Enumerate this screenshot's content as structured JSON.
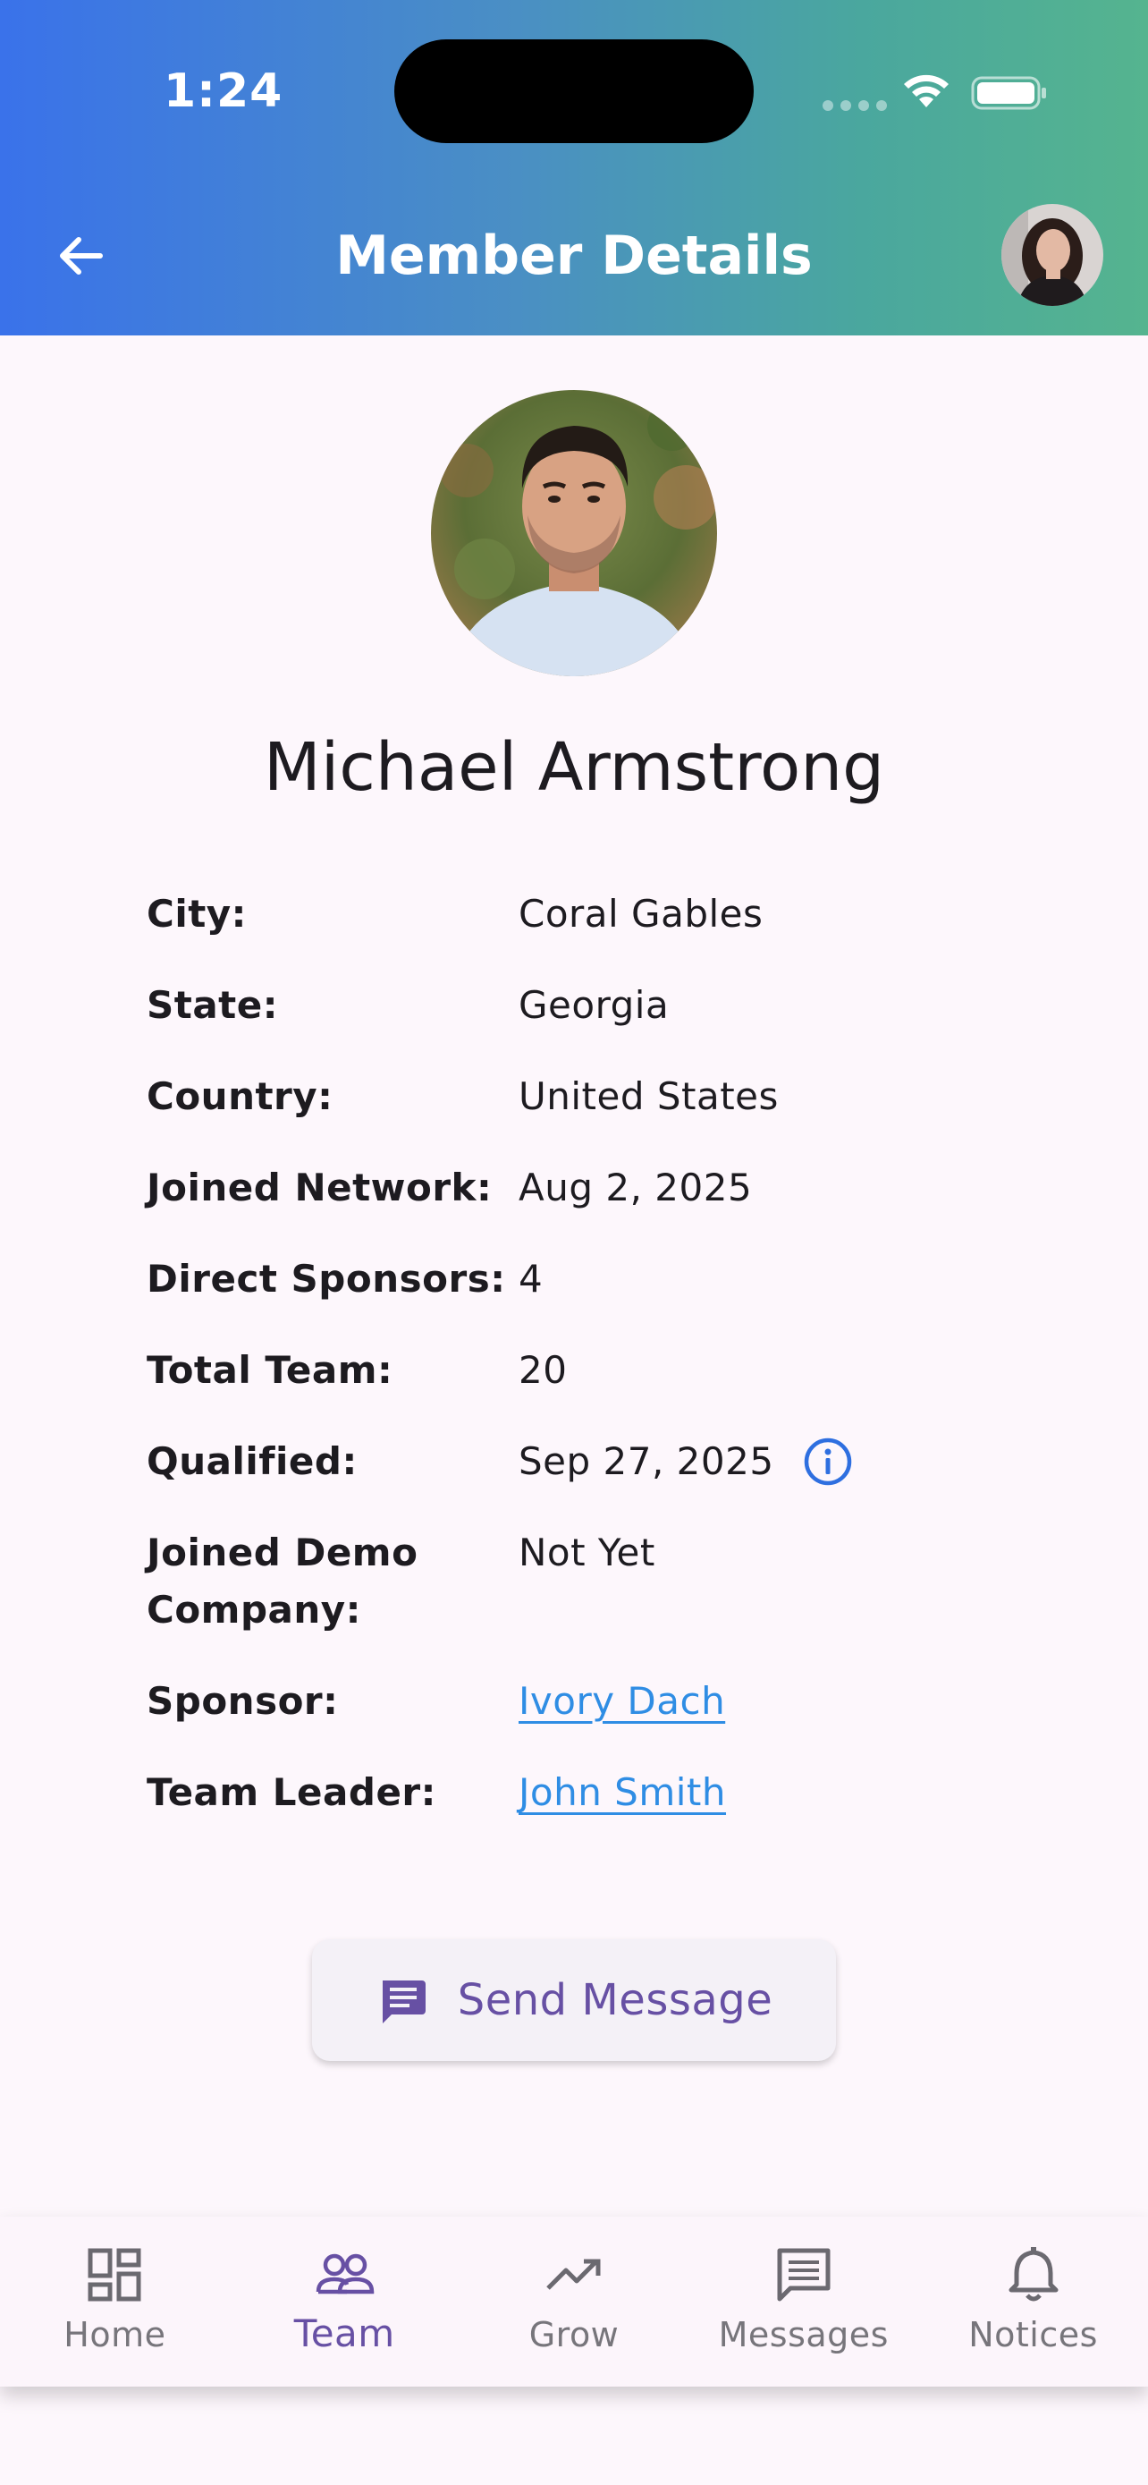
{
  "status_bar": {
    "time": "1:24"
  },
  "header": {
    "title": "Member Details"
  },
  "member": {
    "name": "Michael Armstrong"
  },
  "details": [
    {
      "label": "City:",
      "value": "Coral Gables"
    },
    {
      "label": "State:",
      "value": "Georgia"
    },
    {
      "label": "Country:",
      "value": "United States"
    },
    {
      "label": "Joined Network:",
      "value": "Aug 2, 2025"
    },
    {
      "label": "Direct Sponsors:",
      "value": "4"
    },
    {
      "label": "Total Team:",
      "value": "20"
    },
    {
      "label": "Qualified:",
      "value": "Sep 27, 2025"
    },
    {
      "label": "Joined Demo Company:",
      "value": "Not Yet"
    },
    {
      "label": "Sponsor:",
      "value": "Ivory Dach"
    },
    {
      "label": "Team Leader:",
      "value": "John Smith"
    }
  ],
  "actions": {
    "send_message": "Send Message"
  },
  "nav": {
    "items": [
      {
        "label": "Home",
        "icon": "dashboard-icon"
      },
      {
        "label": "Team",
        "icon": "team-icon"
      },
      {
        "label": "Grow",
        "icon": "trending-up-icon"
      },
      {
        "label": "Messages",
        "icon": "message-icon"
      },
      {
        "label": "Notices",
        "icon": "bell-icon"
      }
    ],
    "active": "Team"
  },
  "colors": {
    "accent": "#6750a4",
    "link": "#2f8de4",
    "info": "#2e6fe0",
    "header_start": "#3a72ea",
    "header_end": "#55b48f"
  }
}
